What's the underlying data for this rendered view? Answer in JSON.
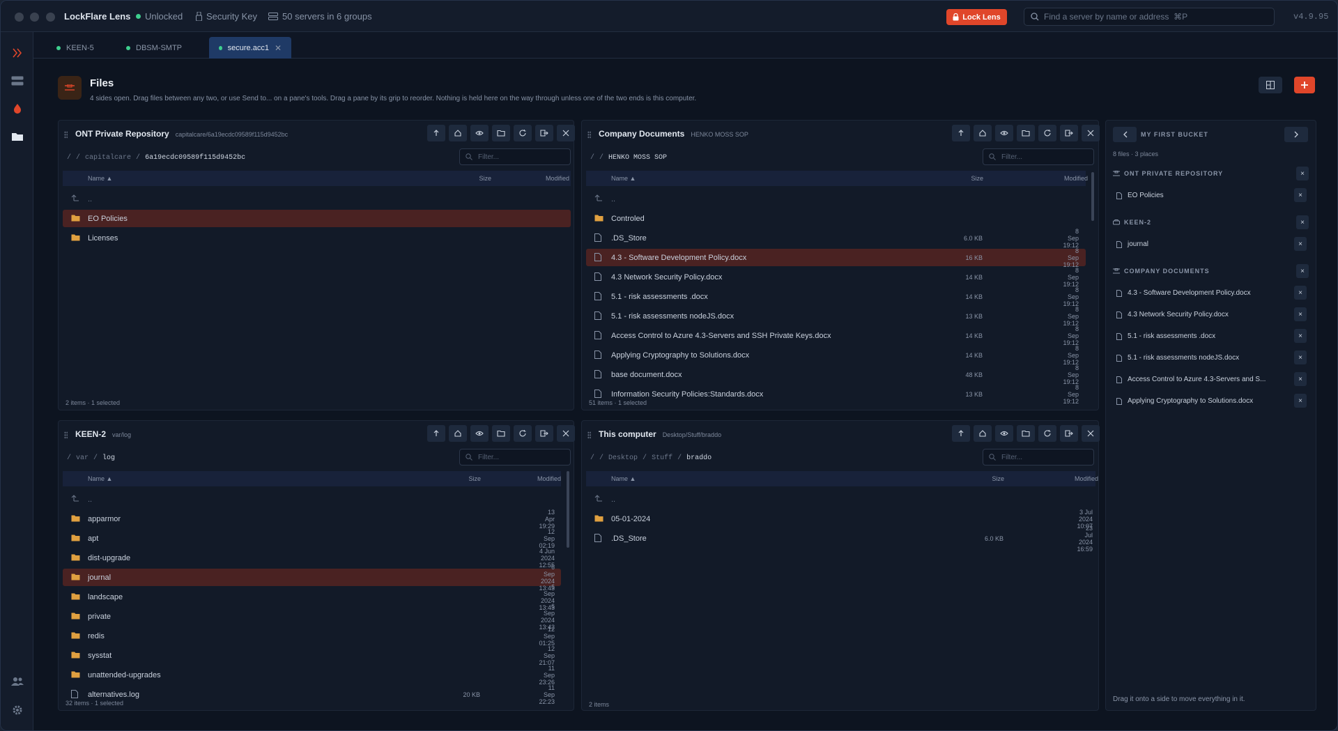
{
  "app": {
    "name": "LockFlare Lens",
    "status": "Unlocked",
    "key": "Security Key",
    "servers": "50 servers in 6 groups",
    "lock_label": "Lock Lens",
    "search_placeholder": "Find a server by name or address  ⌘P",
    "version": "v4.9.95"
  },
  "tabs": [
    {
      "label": "KEEN-5"
    },
    {
      "label": "DBSM-SMTP"
    },
    {
      "label": "secure.acc1"
    }
  ],
  "header": {
    "title": "Files",
    "subtitle": "4 sides open. Drag files between any two, or use Send to... on a pane's tools. Drag a pane by its grip to reorder. Nothing is held here on the way through unless one of the two ends is this computer."
  },
  "panes": {
    "p1": {
      "title": "ONT Private Repository",
      "sub": "capitalcare/6a19ecdc09589f115d9452bc",
      "crumbs": [
        "/",
        "/",
        "capitalcare",
        "/"
      ],
      "crumb_current": "6a19ecdc09589f115d9452bc",
      "filter": "Filter...",
      "cols": {
        "name": "Name ▲",
        "size": "Size",
        "modified": "Modified"
      },
      "up": "..",
      "rows": [
        {
          "name": "EO Policies",
          "size": "",
          "mod": "",
          "type": "folder"
        },
        {
          "name": "Licenses",
          "size": "",
          "mod": "",
          "type": "folder"
        }
      ],
      "footer": "2 items · 1 selected"
    },
    "p2": {
      "title": "Company Documents",
      "sub": "HENKO MOSS SOP",
      "crumbs": [
        "/",
        "/"
      ],
      "crumb_current": "HENKO MOSS SOP",
      "filter": "Filter...",
      "cols": {
        "name": "Name ▲",
        "size": "Size",
        "modified": "Modified"
      },
      "up": "..",
      "rows": [
        {
          "name": "Controled",
          "size": "",
          "mod": "",
          "type": "folder"
        },
        {
          "name": ".DS_Store",
          "size": "6.0 KB",
          "mod": "8 Sep 19:12",
          "type": "file"
        },
        {
          "name": "4.3 - Software Development Policy.docx",
          "size": "16 KB",
          "mod": "8 Sep 19:12",
          "type": "file"
        },
        {
          "name": "4.3 Network Security Policy.docx",
          "size": "14 KB",
          "mod": "8 Sep 19:12",
          "type": "file"
        },
        {
          "name": "5.1 - risk assessments .docx",
          "size": "14 KB",
          "mod": "8 Sep 19:12",
          "type": "file"
        },
        {
          "name": "5.1 - risk assessments nodeJS.docx",
          "size": "13 KB",
          "mod": "8 Sep 19:12",
          "type": "file"
        },
        {
          "name": "Access Control to Azure 4.3-Servers and SSH Private Keys.docx",
          "size": "14 KB",
          "mod": "8 Sep 19:12",
          "type": "file"
        },
        {
          "name": "Applying Cryptography to Solutions.docx",
          "size": "14 KB",
          "mod": "8 Sep 19:12",
          "type": "file"
        },
        {
          "name": "base document.docx",
          "size": "48 KB",
          "mod": "8 Sep 19:12",
          "type": "file"
        },
        {
          "name": "Information Security Policies:Standards.docx",
          "size": "13 KB",
          "mod": "8 Sep 19:12",
          "type": "file"
        }
      ],
      "footer": "51 items · 1 selected"
    },
    "p3": {
      "title": "KEEN-2",
      "sub": "var/log",
      "crumbs": [
        "/",
        "var",
        "/"
      ],
      "crumb_current": "log",
      "filter": "Filter...",
      "cols": {
        "name": "Name ▲",
        "size": "Size",
        "modified": "Modified"
      },
      "up": "..",
      "rows": [
        {
          "name": "apparmor",
          "size": "",
          "mod": "13 Apr 19:29",
          "type": "folder"
        },
        {
          "name": "apt",
          "size": "",
          "mod": "12 Sep 02:19",
          "type": "folder"
        },
        {
          "name": "dist-upgrade",
          "size": "",
          "mod": "4 Jun 2024 12:55",
          "type": "folder"
        },
        {
          "name": "journal",
          "size": "",
          "mod": "6 Sep 2024 13:43",
          "type": "folder"
        },
        {
          "name": "landscape",
          "size": "",
          "mod": "6 Sep 2024 13:43",
          "type": "folder"
        },
        {
          "name": "private",
          "size": "",
          "mod": "6 Sep 2024 13:43",
          "type": "folder"
        },
        {
          "name": "redis",
          "size": "",
          "mod": "12 Sep 01:25",
          "type": "folder"
        },
        {
          "name": "sysstat",
          "size": "",
          "mod": "12 Sep 21:07",
          "type": "folder"
        },
        {
          "name": "unattended-upgrades",
          "size": "",
          "mod": "11 Sep 23:26",
          "type": "folder"
        },
        {
          "name": "alternatives.log",
          "size": "20 KB",
          "mod": "11 Sep 22:23",
          "type": "file"
        }
      ],
      "footer": "32 items · 1 selected"
    },
    "p4": {
      "title": "This computer",
      "sub": "Desktop/Stuff/braddo",
      "crumbs": [
        "/",
        "/",
        "Desktop",
        "/",
        "Stuff",
        "/"
      ],
      "crumb_current": "braddo",
      "filter": "Filter...",
      "cols": {
        "name": "Name ▲",
        "size": "Size",
        "modified": "Modified"
      },
      "up": "..",
      "rows": [
        {
          "name": "05-01-2024",
          "size": "",
          "mod": "3 Jul 2024 10:07",
          "type": "folder"
        },
        {
          "name": ".DS_Store",
          "size": "6.0 KB",
          "mod": "23 Jul 2024 16:59",
          "type": "file"
        }
      ],
      "footer": "2 items"
    }
  },
  "bucket": {
    "title": "MY FIRST BUCKET",
    "sub": "8 files · 3 places",
    "groups": [
      {
        "name": "ONT PRIVATE REPOSITORY",
        "items": [
          "EO Policies"
        ]
      },
      {
        "name": "KEEN-2",
        "items": [
          "journal"
        ]
      },
      {
        "name": "COMPANY DOCUMENTS",
        "items": [
          "4.3 - Software Development Policy.docx",
          "4.3 Network Security Policy.docx",
          "5.1 - risk assessments .docx",
          "5.1 - risk assessments nodeJS.docx",
          "Access Control to Azure 4.3-Servers and S...",
          "Applying Cryptography to Solutions.docx"
        ]
      }
    ],
    "footer": "Drag it onto a side to move everything in it.",
    "remove": "×"
  },
  "colors": {
    "accent": "#e0462a",
    "selected_row": "#4a2222",
    "status_green": "#3ecf8e",
    "folder": "#e0a040"
  }
}
